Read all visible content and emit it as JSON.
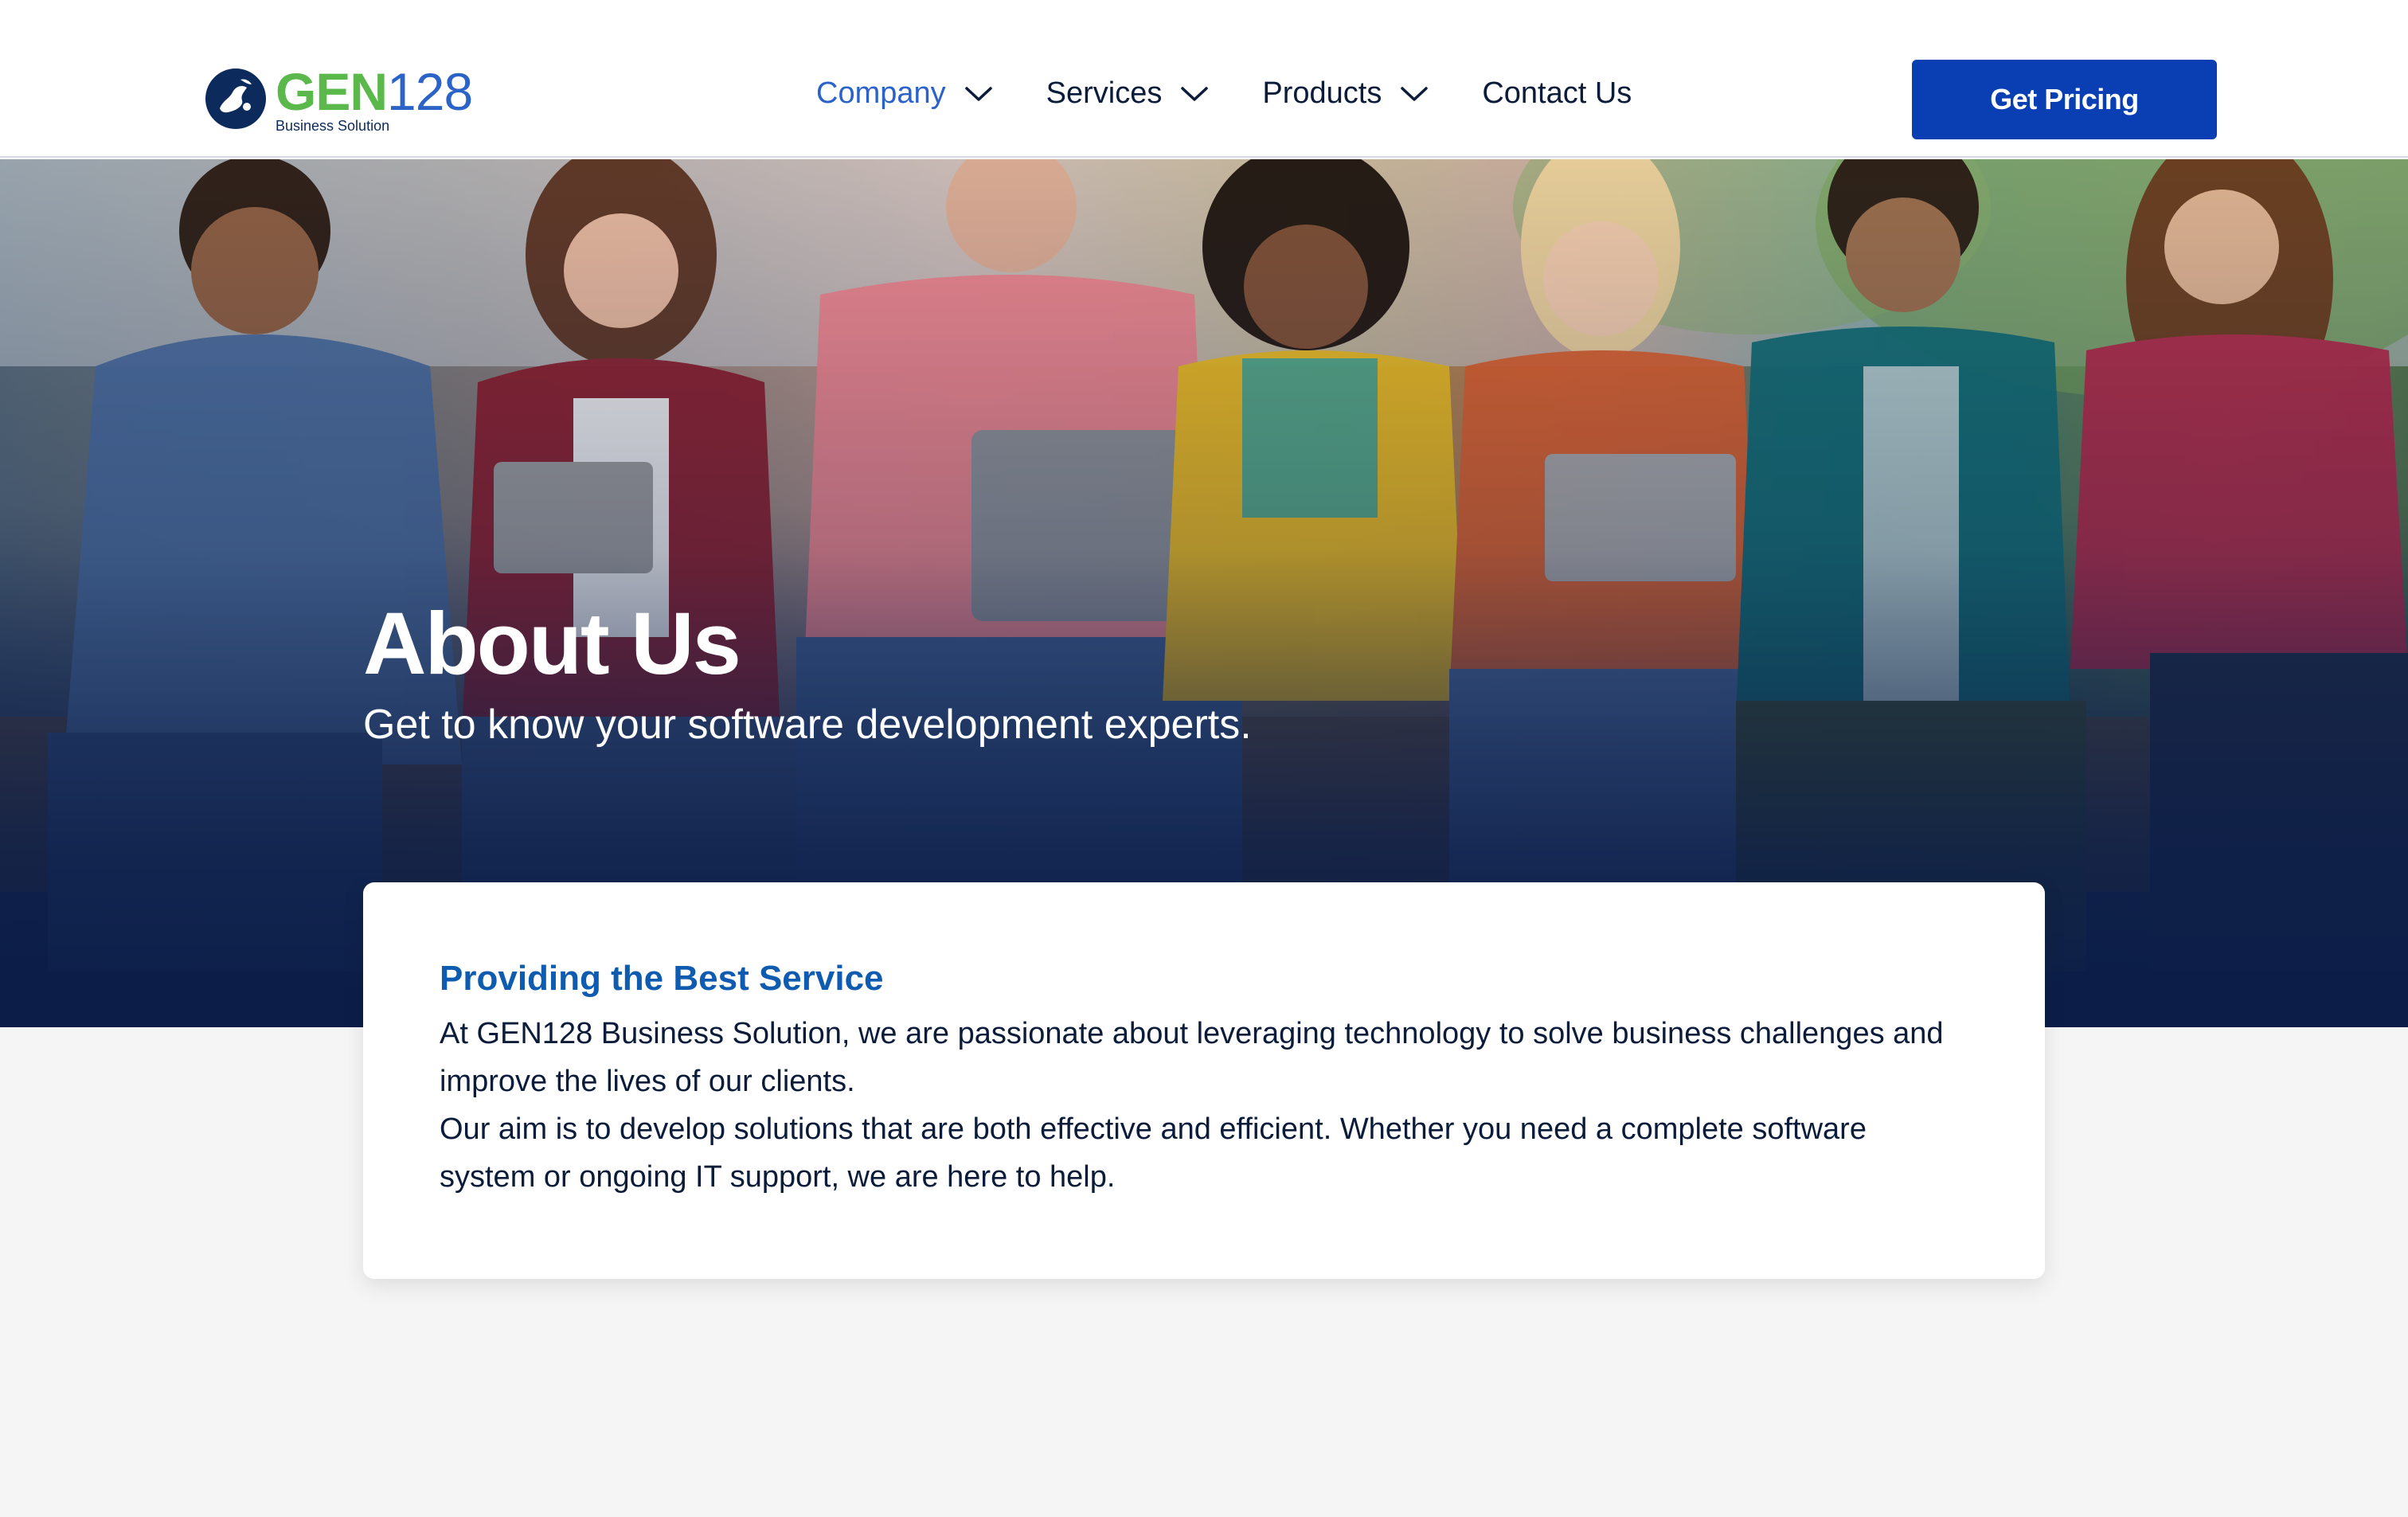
{
  "brand": {
    "name_primary": "GEN",
    "name_secondary": "128",
    "tagline": "Business Solution",
    "icon": "globe-logo-icon",
    "colors": {
      "green": "#5bb84a",
      "blue": "#2b63c7",
      "navy": "#0d2a5c"
    }
  },
  "nav": {
    "items": [
      {
        "label": "Company",
        "has_dropdown": true,
        "active": true
      },
      {
        "label": "Services",
        "has_dropdown": true,
        "active": false
      },
      {
        "label": "Products",
        "has_dropdown": true,
        "active": false
      },
      {
        "label": "Contact Us",
        "has_dropdown": false,
        "active": false
      }
    ],
    "cta_label": "Get Pricing",
    "active_color": "#2a62c9",
    "cta_color": "#0a3fb3"
  },
  "hero": {
    "title": "About Us",
    "subtitle": "Get to know your software development experts."
  },
  "card": {
    "title": "Providing the Best Service",
    "paragraphs": [
      "At GEN128 Business Solution, we are passionate about leveraging technology to solve business challenges and improve the lives of our clients.",
      "Our aim is to develop solutions that are both effective and efficient. Whether you need a complete software system or ongoing IT support, we are here to help."
    ],
    "title_color": "#0f5bb0"
  }
}
